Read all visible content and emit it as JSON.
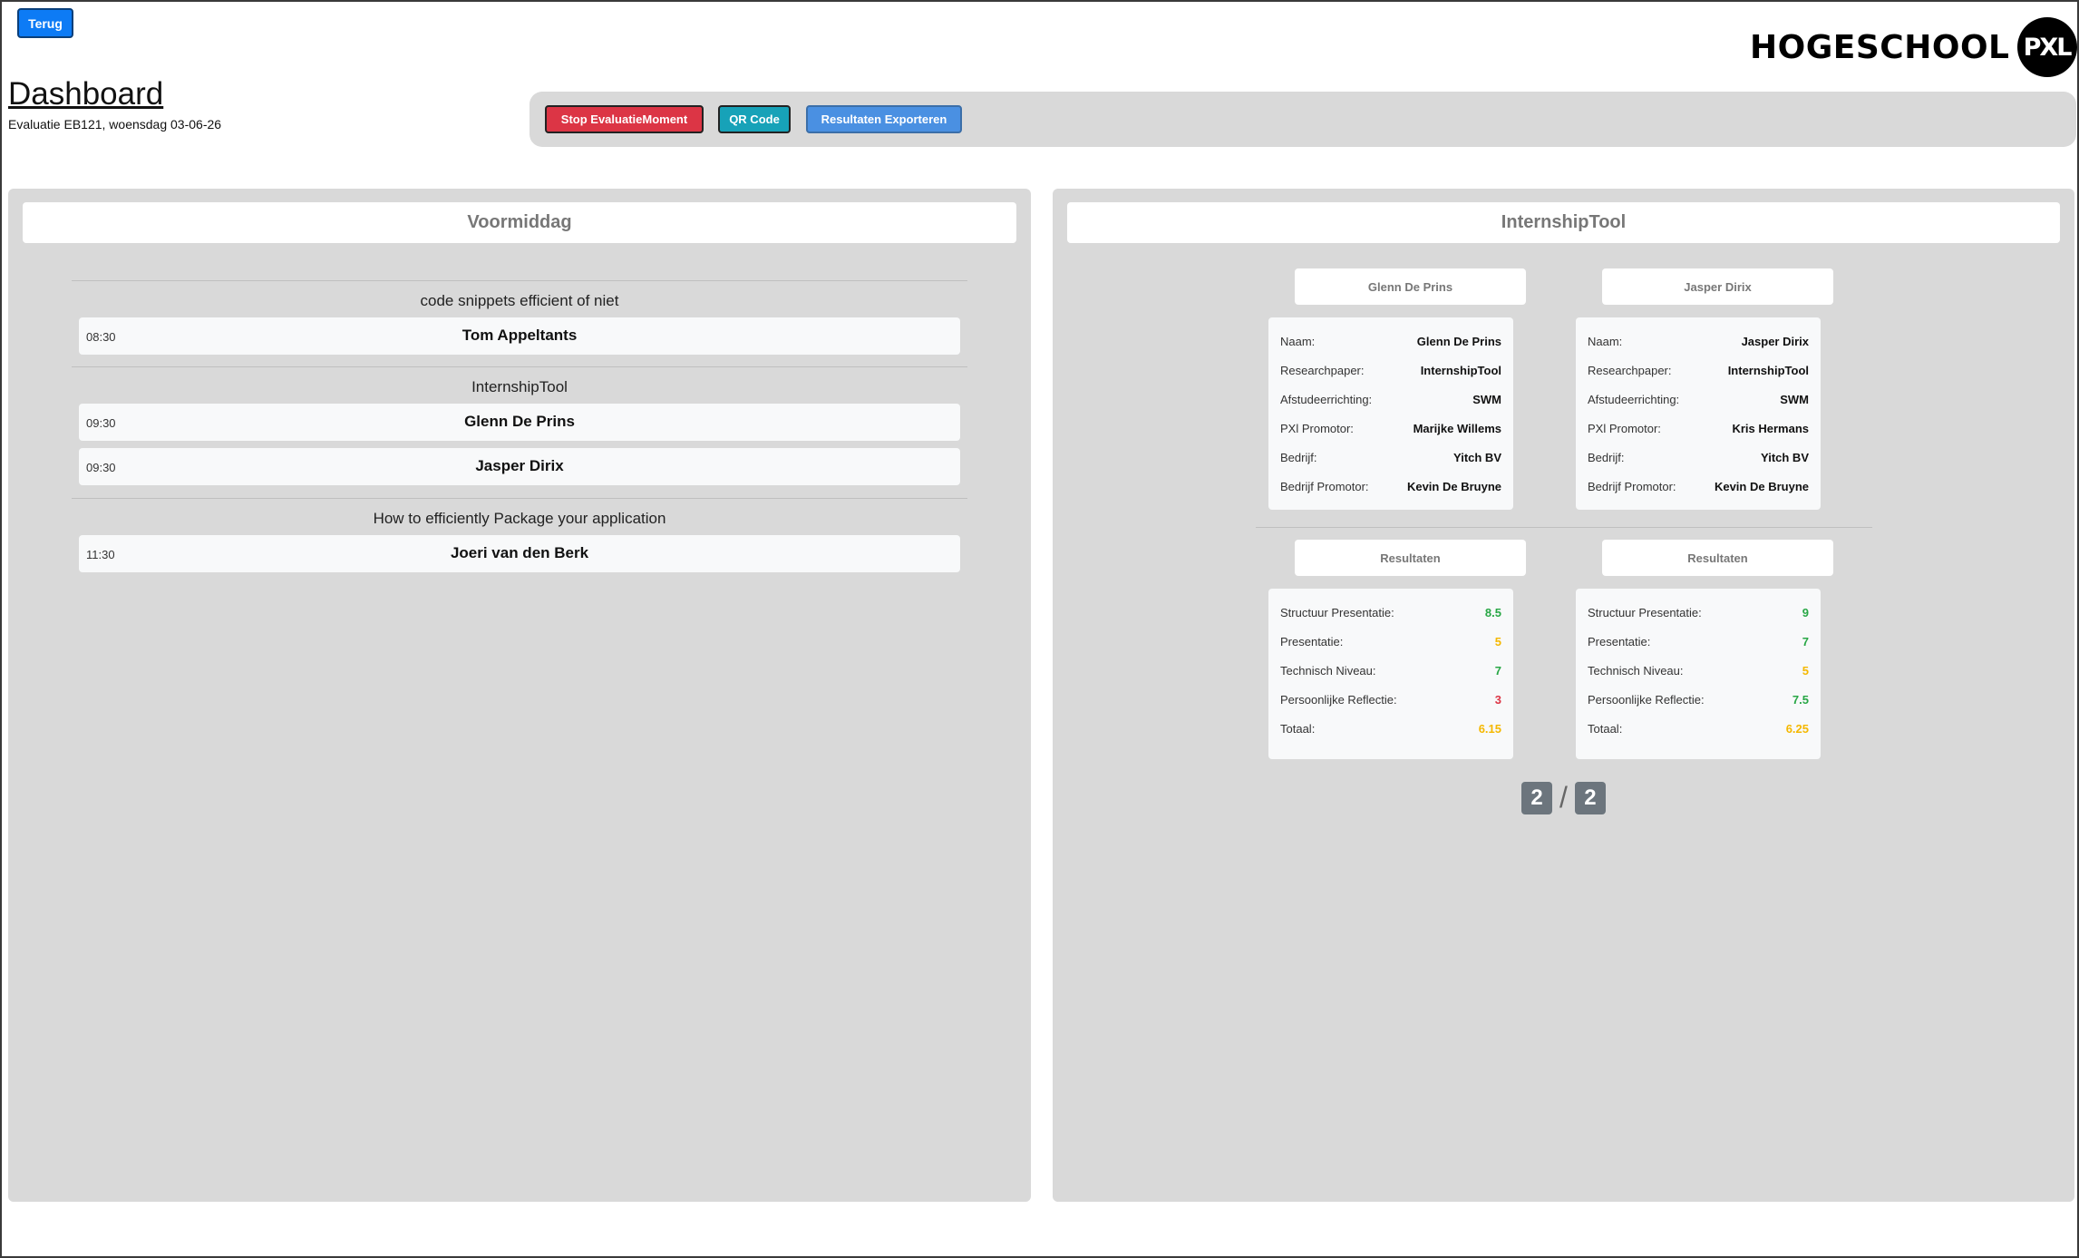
{
  "header": {
    "back_label": "Terug",
    "logo_text": "HOGESCHOOL",
    "logo_mark": "PXL",
    "title": "Dashboard",
    "subtitle": "Evaluatie EB121, woensdag 03-06-26"
  },
  "toolbar": {
    "stop_label": "Stop EvaluatieMoment",
    "qr_label": "QR Code",
    "export_label": "Resultaten Exporteren"
  },
  "schedule": {
    "heading": "Voormiddag",
    "groups": [
      {
        "title": "code snippets efficient of niet",
        "slots": [
          {
            "time": "08:30",
            "name": "Tom Appeltants"
          }
        ]
      },
      {
        "title": "InternshipTool",
        "slots": [
          {
            "time": "09:30",
            "name": "Glenn De Prins"
          },
          {
            "time": "09:30",
            "name": "Jasper Dirix"
          }
        ]
      },
      {
        "title": "How to efficiently Package your application",
        "slots": [
          {
            "time": "11:30",
            "name": "Joeri van den Berk"
          }
        ]
      }
    ]
  },
  "detail": {
    "heading": "InternshipTool",
    "results_label": "Resultaten",
    "info_labels": [
      "Naam:",
      "Researchpaper:",
      "Afstudeerrichting:",
      "PXl Promotor:",
      "Bedrijf:",
      "Bedrijf Promotor:"
    ],
    "result_labels": [
      "Structuur Presentatie:",
      "Presentatie:",
      "Technisch Niveau:",
      "Persoonlijke Reflectie:",
      "Totaal:"
    ],
    "students": [
      {
        "header": "Glenn De Prins",
        "info": [
          "Glenn De Prins",
          "InternshipTool",
          "SWM",
          "Marijke Willems",
          "Yitch BV",
          "Kevin De Bruyne"
        ],
        "results": [
          "8.5",
          "5",
          "7",
          "3",
          "6.15"
        ],
        "result_colors": [
          "#28a745",
          "#f5b800",
          "#28a745",
          "#dc3545",
          "#f5b800"
        ]
      },
      {
        "header": "Jasper Dirix",
        "info": [
          "Jasper Dirix",
          "InternshipTool",
          "SWM",
          "Kris Hermans",
          "Yitch BV",
          "Kevin De Bruyne"
        ],
        "results": [
          "9",
          "7",
          "5",
          "7.5",
          "6.25"
        ],
        "result_colors": [
          "#28a745",
          "#28a745",
          "#f5b800",
          "#28a745",
          "#f5b800"
        ]
      }
    ],
    "pager": {
      "current": "2",
      "separator": "/",
      "total": "2"
    }
  }
}
